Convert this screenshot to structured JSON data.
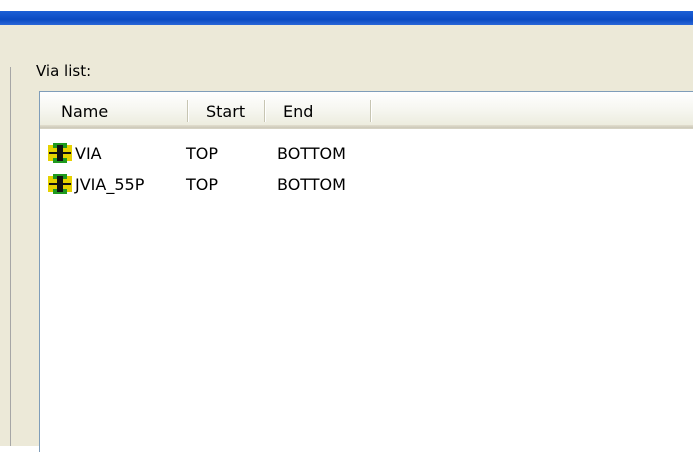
{
  "dialog": {
    "via_list_label": "Via list:"
  },
  "table": {
    "columns": [
      "Name",
      "Start",
      "End"
    ],
    "rows": [
      {
        "name": "VIA",
        "start": "TOP",
        "end": "BOTTOM",
        "icon": "via-padstack-icon"
      },
      {
        "name": "JVIA_55P",
        "start": "TOP",
        "end": "BOTTOM",
        "icon": "via-padstack-icon"
      }
    ]
  },
  "colors": {
    "title_bar": "#0a4ac2",
    "dialog_bg": "#ece9d8",
    "icon_yellow": "#e6d200",
    "icon_green": "#1f9a1f"
  }
}
